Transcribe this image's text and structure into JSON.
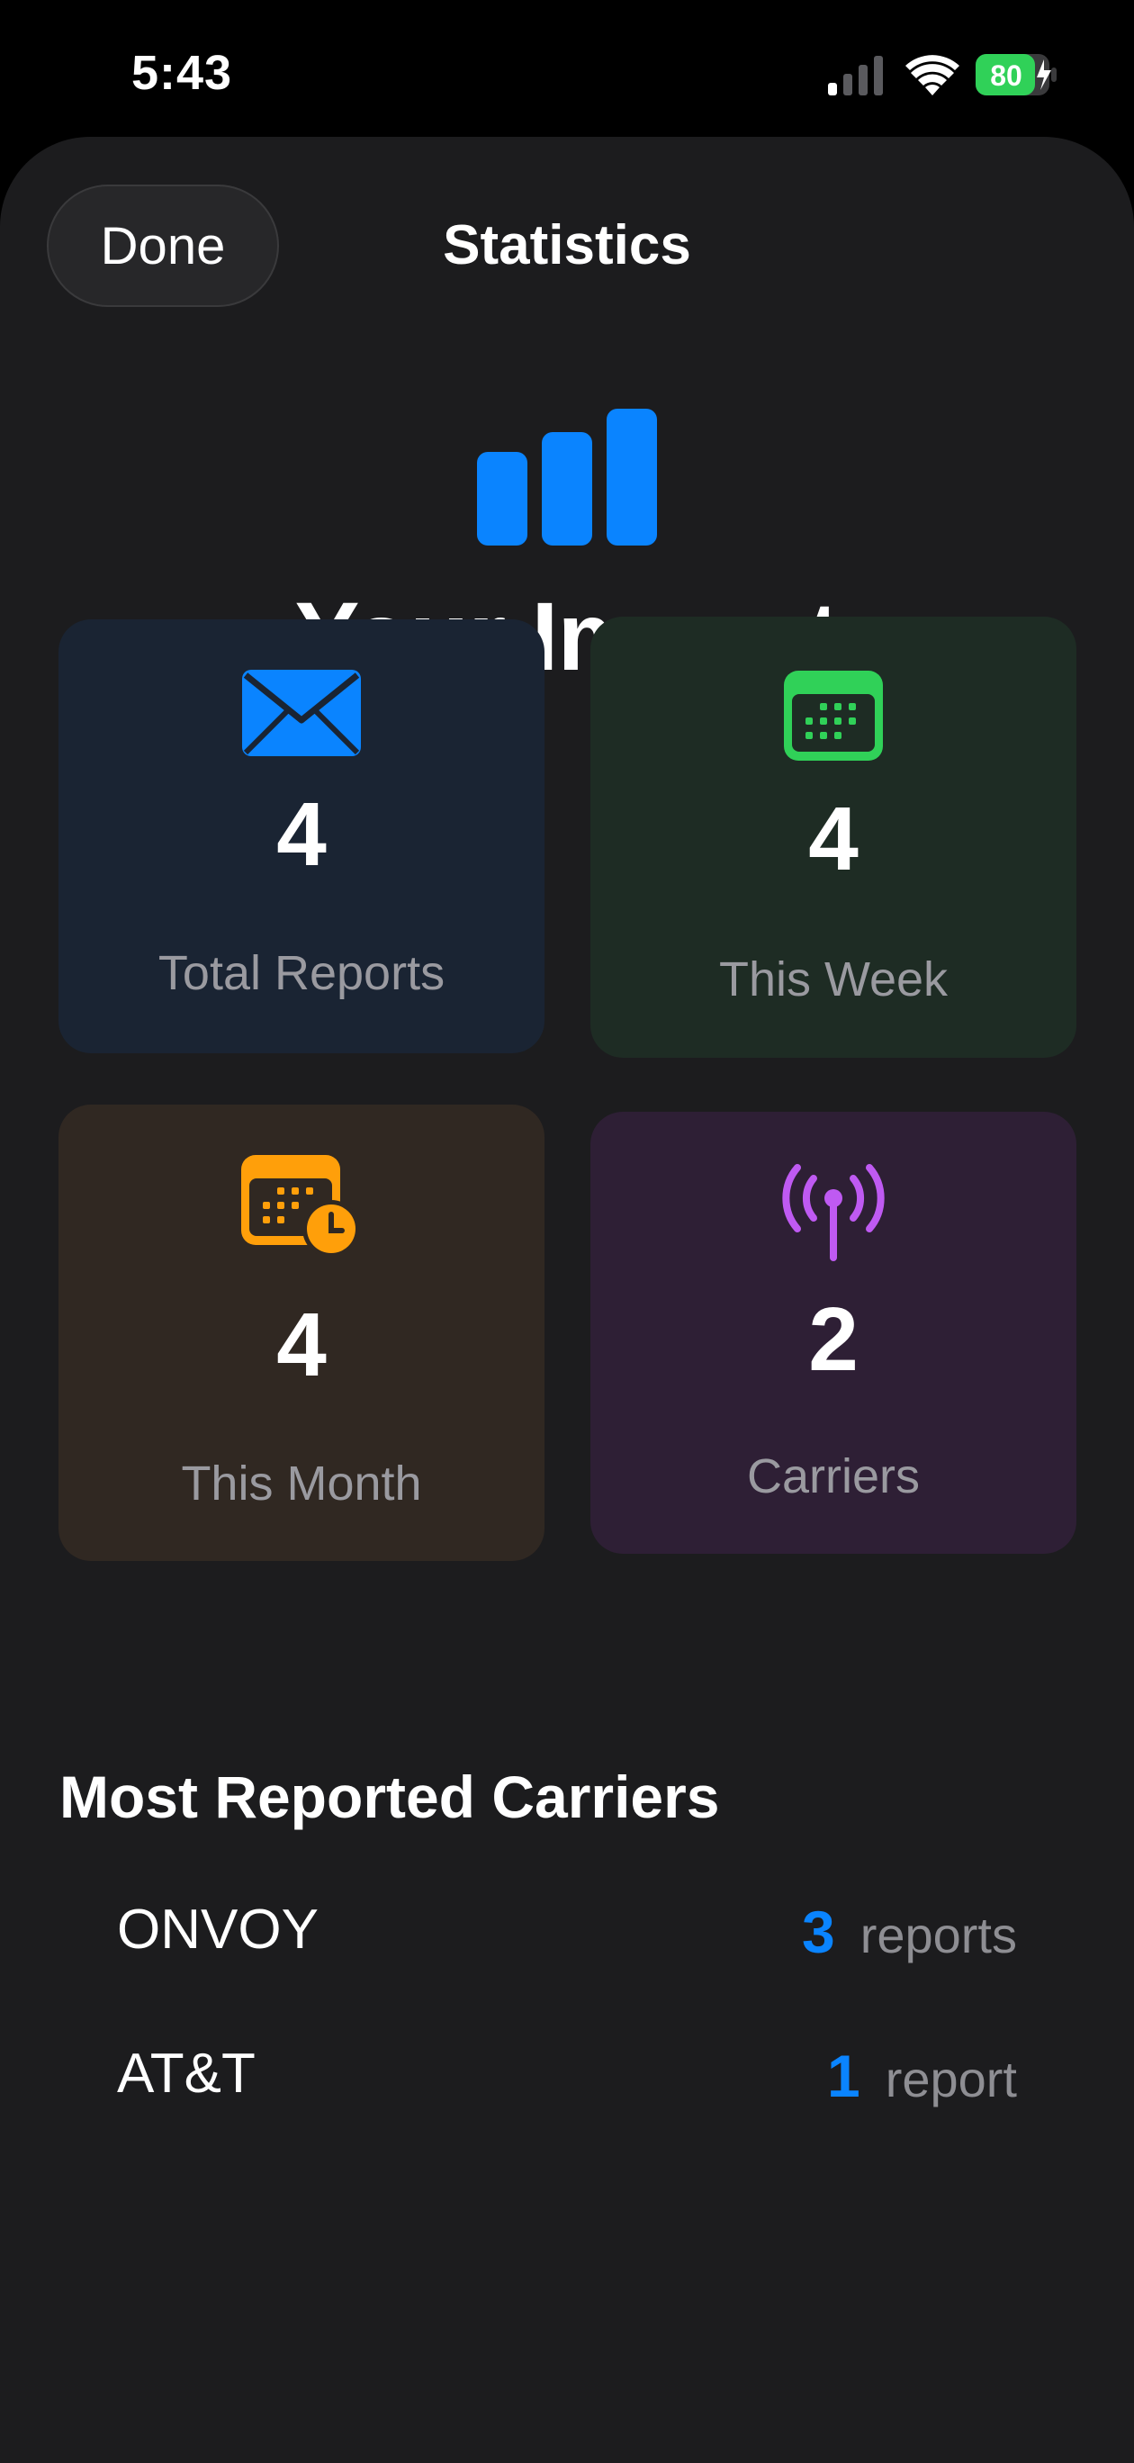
{
  "status_bar": {
    "time": "5:43",
    "battery_level": "80",
    "icons": [
      "cellular-signal-icon",
      "wifi-icon",
      "battery-charging-icon"
    ]
  },
  "nav": {
    "done_label": "Done",
    "title": "Statistics"
  },
  "hero": {
    "icon": "chart-bar-icon",
    "title": "Your Impact"
  },
  "stats": [
    {
      "icon": "envelope-icon",
      "value": "4",
      "label": "Total Reports",
      "accent": "#0a84ff"
    },
    {
      "icon": "calendar-icon",
      "value": "4",
      "label": "This Week",
      "accent": "#30d158"
    },
    {
      "icon": "calendar-clock-icon",
      "value": "4",
      "label": "This Month",
      "accent": "#ff9f0a"
    },
    {
      "icon": "antenna-radiowaves-icon",
      "value": "2",
      "label": "Carriers",
      "accent": "#bf5af2"
    }
  ],
  "carriers_section": {
    "title": "Most Reported Carriers",
    "rows": [
      {
        "name": "ONVOY",
        "count": "3",
        "unit": "reports"
      },
      {
        "name": "AT&T",
        "count": "1",
        "unit": "report"
      }
    ]
  },
  "colors": {
    "background": "#000000",
    "sheet": "#1c1c1e",
    "accent_blue": "#0a84ff",
    "accent_green": "#30d158",
    "accent_orange": "#ff9f0a",
    "accent_purple": "#bf5af2"
  }
}
